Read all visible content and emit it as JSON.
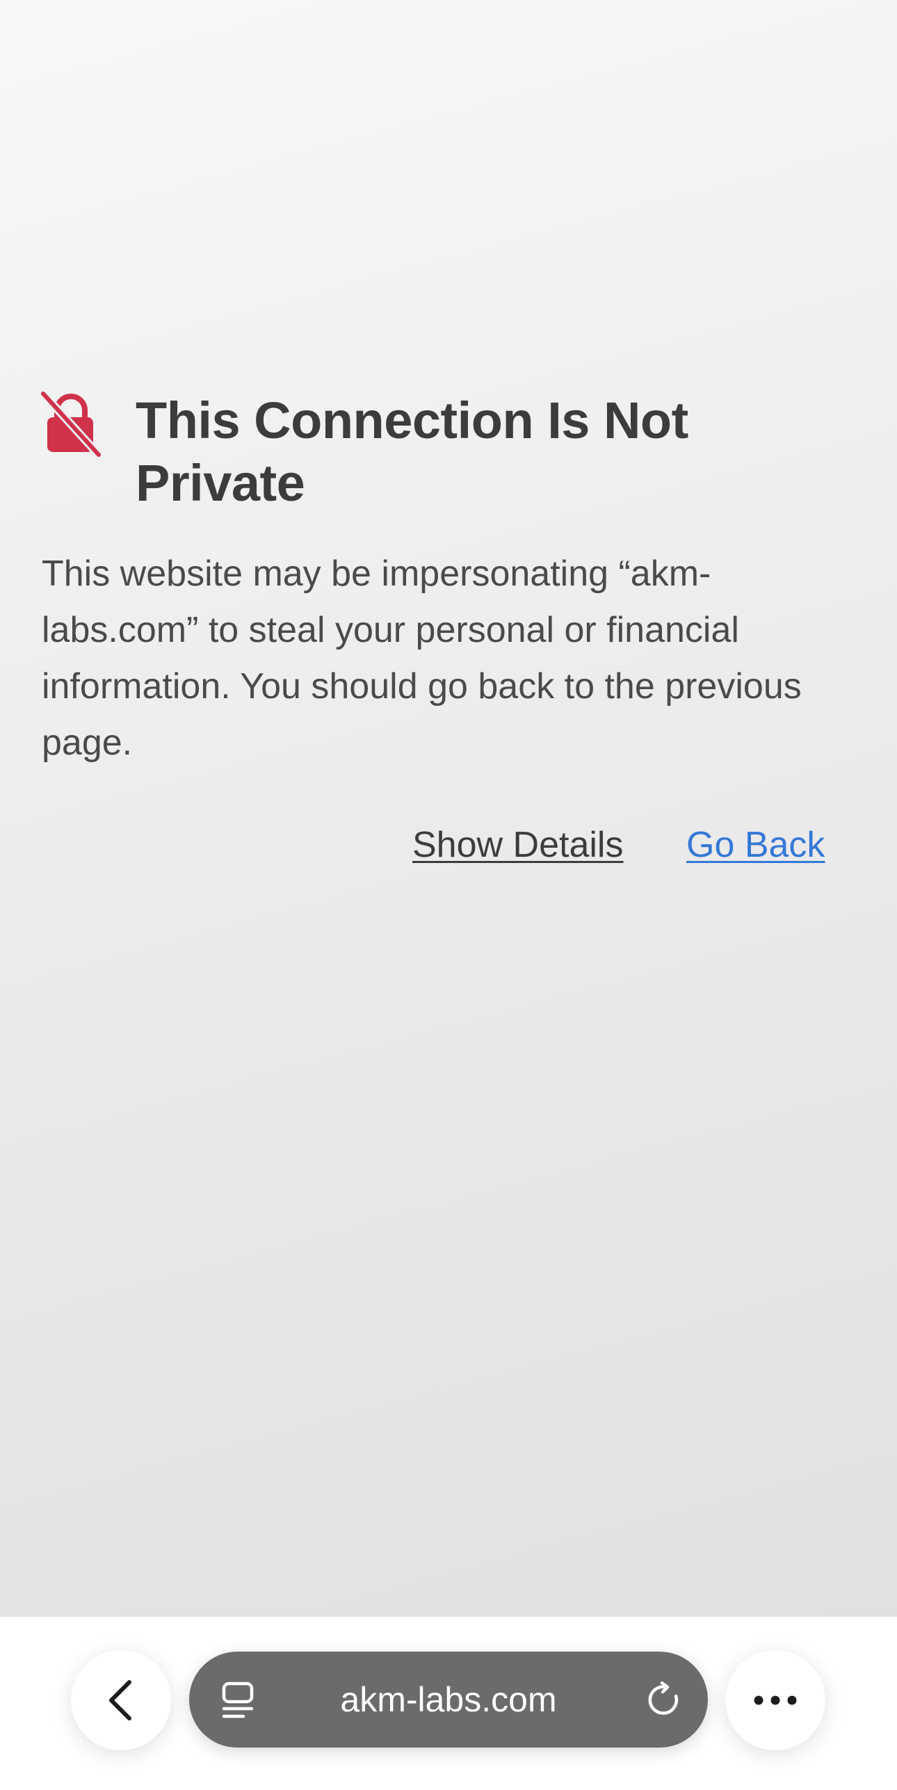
{
  "error_page": {
    "title": "This Connection Is Not Private",
    "message": "This website may be impersonating “akm-labs.com” to steal your personal or financial information. You should go back to the previous page.",
    "show_details_label": "Show Details",
    "go_back_label": "Go Back"
  },
  "toolbar": {
    "url": "akm-labs.com",
    "icons": {
      "back": "chevron-left-icon",
      "tabs": "tabs-icon",
      "reload": "reload-icon",
      "more": "more-icon"
    }
  },
  "colors": {
    "lock_icon": "#d0324a",
    "link_accent": "#3478d6",
    "title_text": "#3c3c3e",
    "address_pill": "#6b6b6b"
  }
}
